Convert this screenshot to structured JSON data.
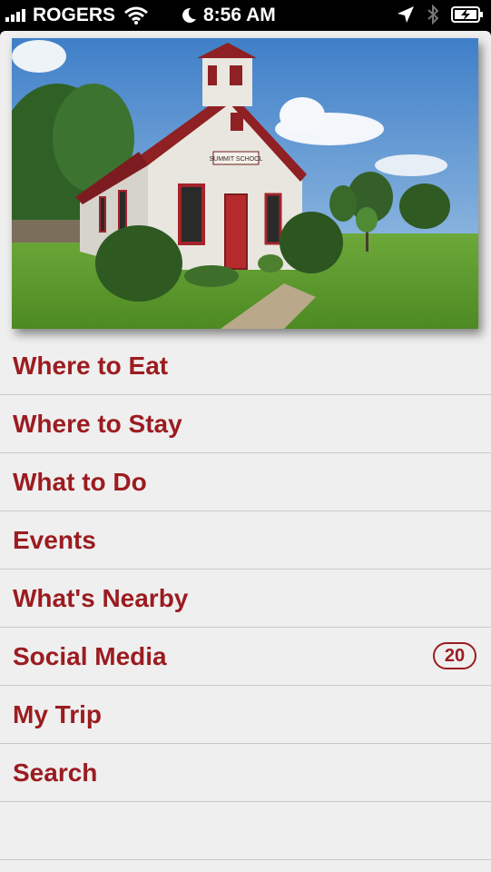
{
  "status_bar": {
    "carrier": "ROGERS",
    "time": "8:56 AM",
    "icons": [
      "signal-bars-icon",
      "wifi-icon",
      "moon-icon",
      "location-arrow-icon",
      "bluetooth-icon",
      "battery-charging-icon"
    ]
  },
  "hero": {
    "sign_text": "SUMMIT SCHOOL"
  },
  "menu": {
    "items": [
      {
        "label": "Where to Eat"
      },
      {
        "label": "Where to Stay"
      },
      {
        "label": "What to Do"
      },
      {
        "label": "Events"
      },
      {
        "label": "What's Nearby"
      },
      {
        "label": "Social Media",
        "badge": "20"
      },
      {
        "label": "My Trip"
      },
      {
        "label": "Search"
      }
    ]
  },
  "colors": {
    "accent": "#9b1c20",
    "background": "#efefef",
    "divider": "#c9c9c9"
  }
}
